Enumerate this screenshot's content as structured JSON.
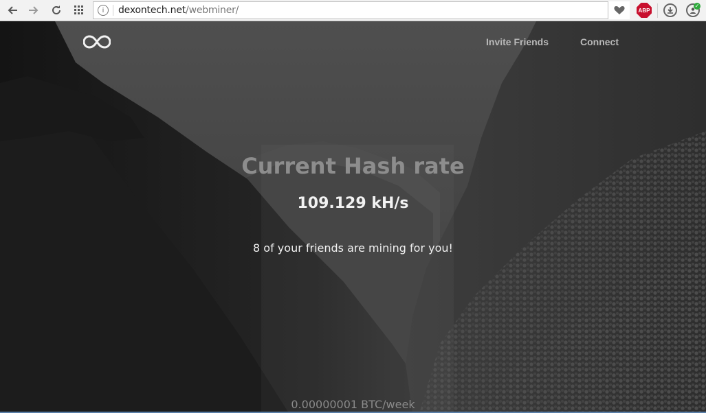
{
  "browser": {
    "url_domain": "dexontech.net",
    "url_path": "/webminer/",
    "abp_label": "ABP",
    "icons": [
      "back-icon",
      "forward-icon",
      "reload-icon",
      "apps-grid-icon",
      "site-info-icon",
      "heart-icon",
      "adblock-icon",
      "download-icon",
      "profile-extension-icon"
    ]
  },
  "nav": {
    "logo_icon": "infinity-icon",
    "invite_label": "Invite Friends",
    "connect_label": "Connect"
  },
  "hero": {
    "title": "Current Hash rate",
    "hash_rate": "109.129 kH/s",
    "friends_message": "8 of your friends are mining for you!",
    "earn_rate": "0.00000001 BTC/week"
  },
  "colors": {
    "nav_link": "#b9b9b9",
    "title": "#8d8d8d",
    "text_bright": "#f2f2f2",
    "abp_red": "#c8102e"
  }
}
